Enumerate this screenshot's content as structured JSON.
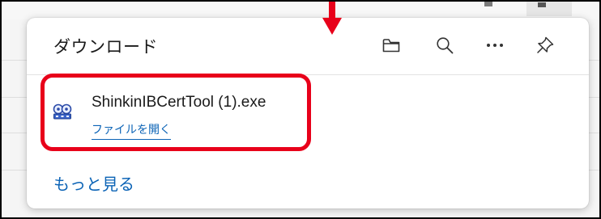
{
  "downloads_panel": {
    "title": "ダウンロード",
    "header_buttons": [
      {
        "name": "open-downloads-folder-button",
        "icon": "folder-icon"
      },
      {
        "name": "search-downloads-button",
        "icon": "search-icon"
      },
      {
        "name": "more-options-button",
        "icon": "more-icon"
      },
      {
        "name": "pin-button",
        "icon": "pin-icon"
      }
    ],
    "items": [
      {
        "file_name": "ShinkinIBCertTool (1).exe",
        "action_label": "ファイルを開く",
        "icon": "installer-icon"
      }
    ],
    "see_more_label": "もっと見る"
  },
  "colors": {
    "link": "#0b63b6",
    "highlight": "#e8001a",
    "text": "#1a1a1a",
    "panel_bg": "#ffffff"
  }
}
